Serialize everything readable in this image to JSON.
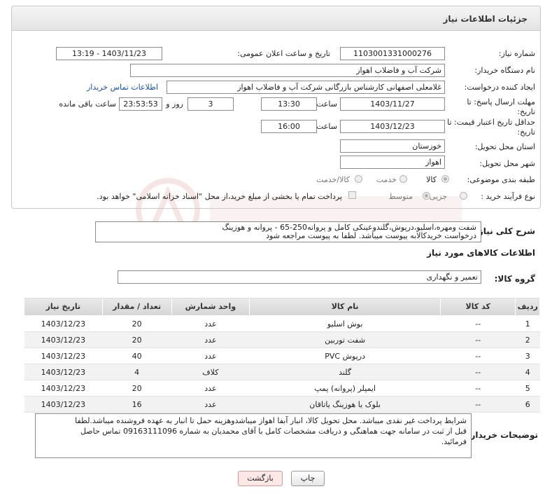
{
  "header": {
    "title": "جزئیات اطلاعات نیاز"
  },
  "fields": {
    "need_number_label": "شماره نیاز:",
    "need_number": "1103001331000276",
    "announce_label": "تاریخ و ساعت اعلان عمومی:",
    "announce_value": "1403/11/23 - 13:19",
    "buyer_org_label": "نام دستگاه خریدار:",
    "buyer_org": "شرکت آب و فاضلاب اهواز",
    "creator_label": "ایجاد کننده درخواست:",
    "creator": "غلامعلی اصفهانی کارشناس بازرگانی شرکت آب و فاضلاب اهواز",
    "contact_link": "اطلاعات تماس خریدار",
    "send_deadline_label": "مهلت ارسال پاسخ: تا تاریخ:",
    "send_date": "1403/11/27",
    "time_label": "ساعت",
    "send_time": "13:30",
    "days_value": "3",
    "days_label": "روز و",
    "remaining_time": "23:53:53",
    "remaining_label": "ساعت باقی مانده",
    "price_validity_label": "حداقل تاریخ اعتبار قیمت: تا تاریخ:",
    "price_date": "1403/12/23",
    "time_label2": "ساعت",
    "price_time": "16:00",
    "province_label": "استان محل تحویل:",
    "province": "خوزستان",
    "city_label": "شهر محل تحویل:",
    "city": "اهواز",
    "category_label": "طبقه بندی موضوعی:",
    "cat_goods": "کالا",
    "cat_service": "خدمت",
    "cat_goods_service": "کالا/خدمت",
    "process_label": "نوع فرآیند خرید :",
    "proc_partial": "جزیی",
    "proc_medium": "متوسط",
    "payment_note": "پرداخت تمام یا بخشی از مبلغ خرید،از محل \"اسناد خزانه اسلامی\" خواهد بود."
  },
  "description": {
    "label": "شرح کلی نیاز:",
    "line1": "شفت ومهره،اسلیو،درپوش،گلندوعینکی کامل و پروانه250-65 - پروانه و هوزینگ",
    "line2": "درخواست خریدکالابه پیوست میباشد. لطفا به پیوست مراجعه شود"
  },
  "goods": {
    "section_title": "اطلاعات کالاهای مورد نیاز",
    "group_label": "گروه کالا:",
    "group_value": "تعمیر و نگهداری",
    "columns": [
      "ردیف",
      "کد کالا",
      "نام کالا",
      "واحد شمارش",
      "تعداد / مقدار",
      "تاریخ نیاز"
    ],
    "rows": [
      [
        "1",
        "--",
        "بوش اسلیو",
        "عدد",
        "20",
        "1403/12/23"
      ],
      [
        "2",
        "--",
        "شفت توربین",
        "عدد",
        "20",
        "1403/12/23"
      ],
      [
        "3",
        "--",
        "درپوش PVC",
        "عدد",
        "40",
        "1403/12/23"
      ],
      [
        "4",
        "--",
        "گلند",
        "کلاف",
        "4",
        "1403/12/23"
      ],
      [
        "5",
        "--",
        "ایمپلر (پروانه) پمپ",
        "عدد",
        "20",
        "1403/12/23"
      ],
      [
        "6",
        "--",
        "بلوک یا هوزینگ یاتاقان",
        "عدد",
        "16",
        "1403/12/23"
      ]
    ]
  },
  "buyer_notes": {
    "label": "توضیحات خریدار:",
    "line1": "شرایط پرداخت غیر نقدی میباشد. محل تحویل کالا، انبار آبفا اهواز میباشدوهزینه حمل تا انبار به عهده فروشنده میباشد.لطفا",
    "line2": "قبل از ثبت در سامانه جهت هماهنگی و دریافت مشخصات کامل با آقای  محمدیان به شماره 09163111096 تماس حاصل",
    "line3": "فرمائید."
  },
  "buttons": {
    "print": "چاپ",
    "back": "بازگشت"
  }
}
